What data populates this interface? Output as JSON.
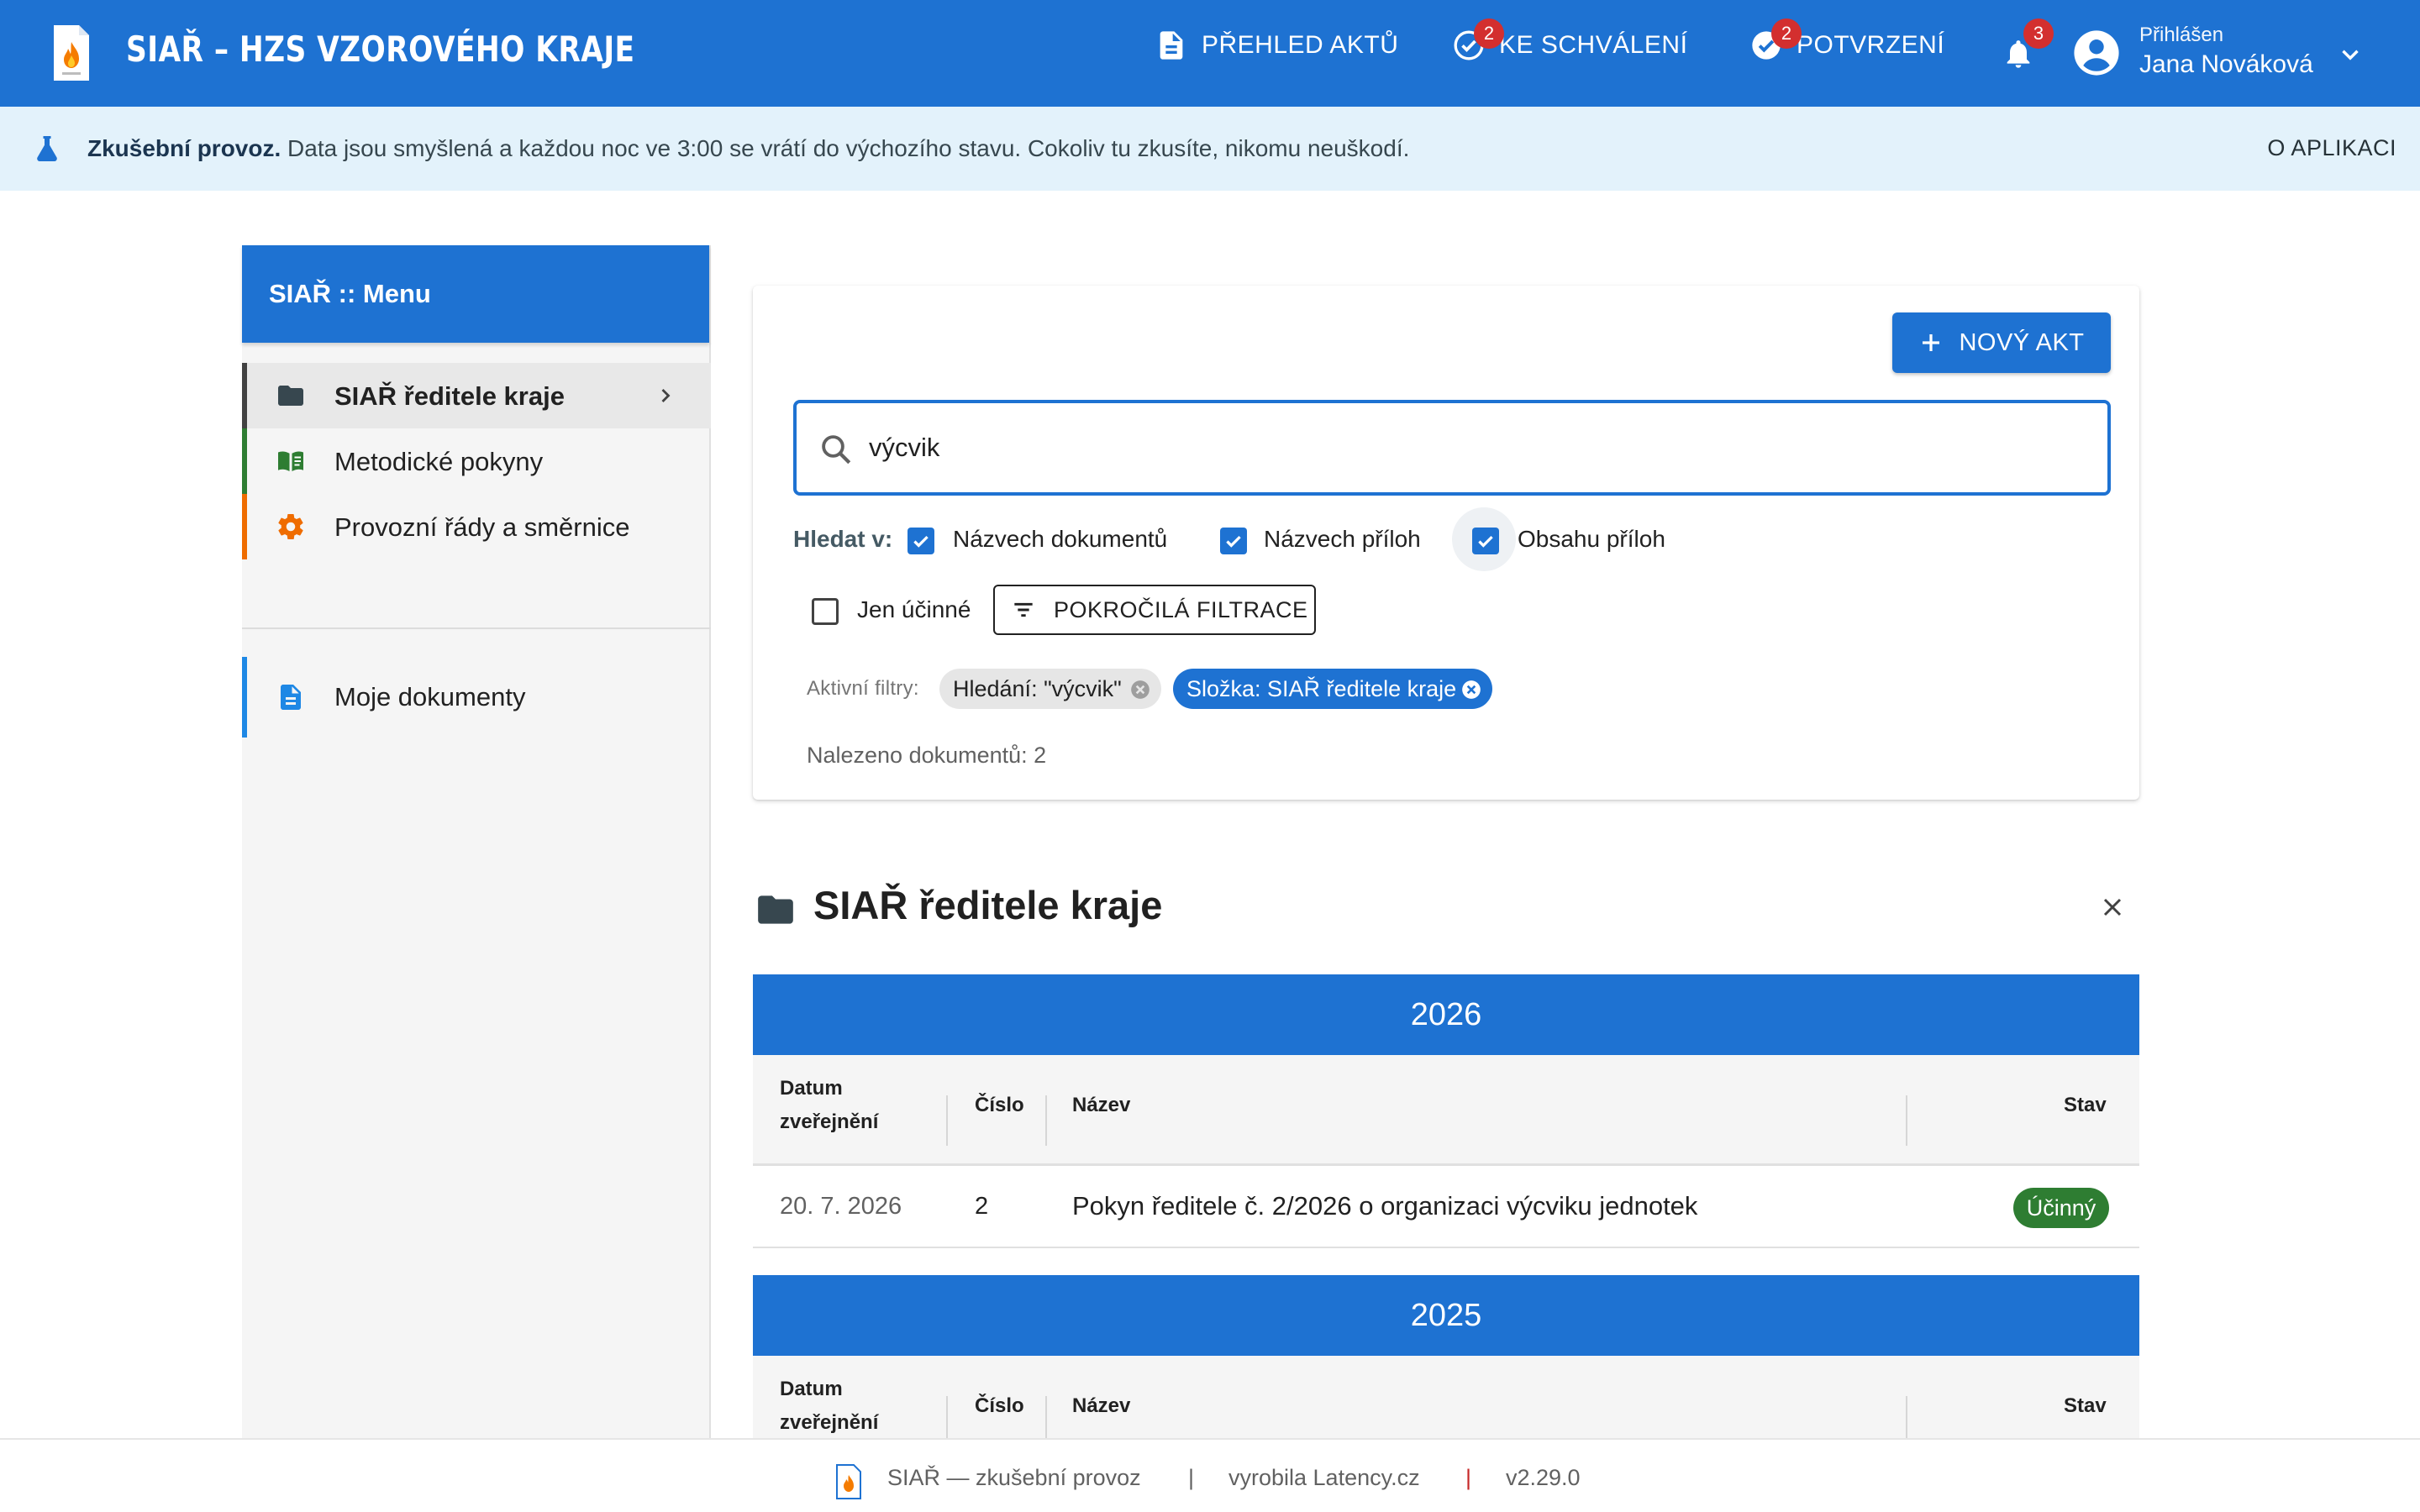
{
  "app": {
    "title": "SIAŘ – HZS VZOROVÉHO KRAJE"
  },
  "header": {
    "nav": [
      {
        "label": "PŘEHLED AKTŮ",
        "icon": "document-icon"
      },
      {
        "label": "KE SCHVÁLENÍ",
        "icon": "check-circle-outline-icon",
        "badge": "2"
      },
      {
        "label": "POTVRZENÍ",
        "icon": "check-circle-icon",
        "badge": "2"
      }
    ],
    "notifications_badge": "3",
    "user": {
      "label": "Přihlášen",
      "name": "Jana Nováková"
    }
  },
  "notice": {
    "bold": "Zkušební provoz.",
    "text": " Data jsou smyšlená a každou noc ve 3:00 se vrátí do výchozího stavu. Cokoliv tu zkusíte, nikomu neuškodí.",
    "about": "O APLIKACI"
  },
  "sidebar": {
    "title": "SIAŘ :: Menu",
    "items": [
      {
        "label": "SIAŘ ředitele kraje",
        "icon": "folder-icon",
        "accent": "#424242",
        "active": true
      },
      {
        "label": "Metodické pokyny",
        "icon": "book-icon",
        "accent": "#2e7d32"
      },
      {
        "label": "Provozní řády a směrnice",
        "icon": "gear-icon",
        "accent": "#ef6c00"
      }
    ],
    "my_docs": {
      "label": "Moje dokumenty",
      "icon": "document-icon",
      "accent": "#1e88e5"
    }
  },
  "search": {
    "new_button": "NOVÝ AKT",
    "query": "výcvik",
    "search_in_label": "Hledat v:",
    "options": [
      {
        "label": "Názvech dokumentů",
        "checked": true
      },
      {
        "label": "Názvech příloh",
        "checked": true
      },
      {
        "label": "Obsahu příloh",
        "checked": true
      }
    ],
    "only_effective": {
      "label": "Jen účinné",
      "checked": false
    },
    "advanced_filter": "POKROČILÁ FILTRACE",
    "active_filters_label": "Aktivní filtry:",
    "chips": [
      "Hledání: \"výcvik\"",
      "Složka: SIAŘ ředitele kraje"
    ],
    "found": "Nalezeno dokumentů: 2"
  },
  "folder": {
    "title": "SIAŘ ředitele kraje",
    "columns": {
      "date_line1": "Datum",
      "date_line2": "zveřejnění",
      "number": "Číslo",
      "name": "Název",
      "status": "Stav"
    },
    "groups": [
      {
        "year": "2026",
        "rows": [
          {
            "date": "20. 7. 2026",
            "number": "2",
            "name": "Pokyn ředitele č. 2/2026 o organizaci výcviku jednotek",
            "status": "Účinný"
          }
        ]
      },
      {
        "year": "2025",
        "rows": []
      }
    ]
  },
  "footer": {
    "app": "SIAŘ — zkušební provoz",
    "maker": "vyrobila Latency.cz",
    "version": "v2.29.0"
  },
  "colors": {
    "primary": "#1e72d2",
    "notice_bg": "#e3f2fb",
    "status_effective": "#2e7d32",
    "badge": "#d32f2f"
  }
}
